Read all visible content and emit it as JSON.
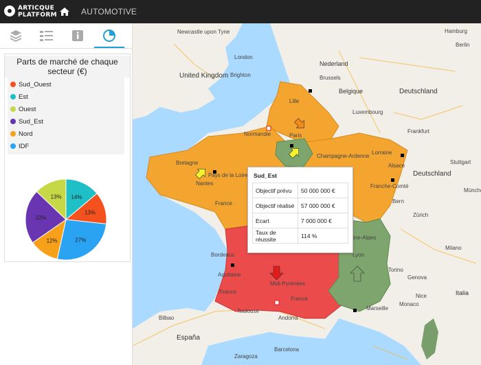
{
  "app": {
    "logo_line1": "ARTICQUE",
    "logo_line2": "PLATFORM",
    "nav_title": "AUTOMOTIVE"
  },
  "sidebar": {
    "tabs": [
      {
        "icon": "layers-icon",
        "active": false
      },
      {
        "icon": "list-icon",
        "active": false
      },
      {
        "icon": "info-icon",
        "active": false
      },
      {
        "icon": "pie-chart-icon",
        "active": true
      }
    ]
  },
  "chart_data": {
    "type": "pie",
    "title": "Parts de marché de chaque secteur (€)",
    "categories": [
      "Sud_Ouest",
      "Est",
      "Ouest",
      "Sud_Est",
      "Nord",
      "IDF"
    ],
    "values": [
      13,
      14,
      13,
      22,
      12,
      27
    ],
    "labels": [
      "13%",
      "14%",
      "13%",
      "22%",
      "12%",
      "27%"
    ],
    "colors": [
      "#f4511e",
      "#1fbfc8",
      "#c6d845",
      "#6a35b0",
      "#f7a11b",
      "#2aa3f2"
    ],
    "legend_position": "top"
  },
  "map": {
    "labels": [
      "Newcastle upon Tyne",
      "United Kingdom",
      "London",
      "Brighton",
      "Nederland",
      "Brussels",
      "Belgique",
      "Luxembourg",
      "Deutschland",
      "Paris",
      "Normandie",
      "Bretagne",
      "Pays de la Loire",
      "Champagne-Ardenne",
      "Lorraine",
      "Alsace",
      "Franche-Comté",
      "Bern",
      "Rhône-Alpes",
      "Aquitaine",
      "Midi-Pyrénées",
      "France",
      "Andorra",
      "España",
      "Milano",
      "Genova",
      "Italia",
      "Hamburg",
      "Berlin",
      "Frankfurt",
      "Stuttgart",
      "München",
      "Zürich",
      "Torino",
      "Marseille",
      "Toulouse",
      "Bordeaux",
      "Nantes",
      "Lyon",
      "Barcelona",
      "Zaragoza",
      "Bilbao",
      "Monaco",
      "Nice",
      "Lille"
    ],
    "tooltip": {
      "title": "Sud_Est",
      "rows": [
        {
          "label": "Objectif prévu",
          "value": "50 000 000 €"
        },
        {
          "label": "Objectif réalisé",
          "value": "57 000 000 €"
        },
        {
          "label": "Ecart",
          "value": "7 000 000 €"
        },
        {
          "label": "Taux de réussite",
          "value": "114 %"
        }
      ]
    }
  }
}
